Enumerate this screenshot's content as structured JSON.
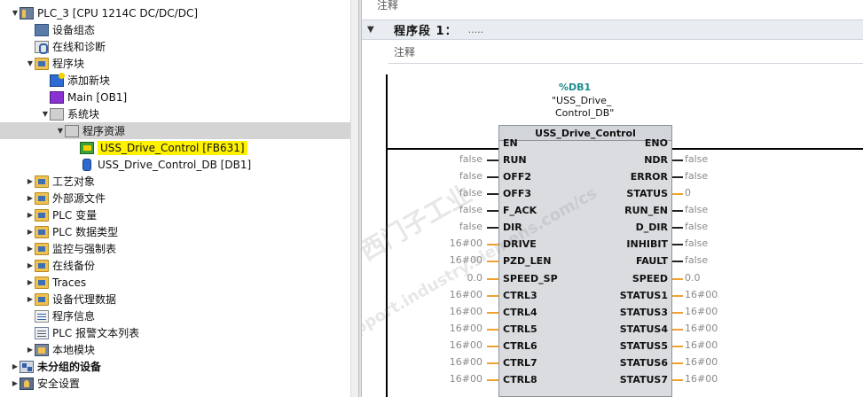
{
  "tree": {
    "items": [
      {
        "label": "PLC_3 [CPU 1214C DC/DC/DC]",
        "icon": "plc-icon",
        "arrow": "▼",
        "indent": 0,
        "bold": false
      },
      {
        "label": "设备组态",
        "icon": "device-config-icon",
        "arrow": "",
        "indent": 1
      },
      {
        "label": "在线和诊断",
        "icon": "online-diagnostics-icon",
        "arrow": "",
        "indent": 1
      },
      {
        "label": "程序块",
        "icon": "folder-icon",
        "arrow": "▼",
        "indent": 1
      },
      {
        "label": "添加新块",
        "icon": "add-block-icon",
        "arrow": "",
        "indent": 2
      },
      {
        "label": "Main [OB1]",
        "icon": "ob-icon",
        "arrow": "",
        "indent": 2
      },
      {
        "label": "系统块",
        "icon": "system-block-icon",
        "arrow": "▼",
        "indent": 2
      },
      {
        "label": "程序资源",
        "icon": "system-block-icon",
        "arrow": "▼",
        "indent": 3
      },
      {
        "label": "USS_Drive_Control [FB631]",
        "icon": "fb-icon",
        "arrow": "",
        "indent": 4
      },
      {
        "label": "USS_Drive_Control_DB [DB1]",
        "icon": "db-icon",
        "arrow": "",
        "indent": 4
      },
      {
        "label": "工艺对象",
        "icon": "folder-icon",
        "arrow": "▶",
        "indent": 1
      },
      {
        "label": "外部源文件",
        "icon": "folder-icon",
        "arrow": "▶",
        "indent": 1
      },
      {
        "label": "PLC 变量",
        "icon": "folder-icon",
        "arrow": "▶",
        "indent": 1
      },
      {
        "label": "PLC 数据类型",
        "icon": "folder-icon",
        "arrow": "▶",
        "indent": 1
      },
      {
        "label": "监控与强制表",
        "icon": "folder-icon",
        "arrow": "▶",
        "indent": 1
      },
      {
        "label": "在线备份",
        "icon": "folder-icon",
        "arrow": "▶",
        "indent": 1
      },
      {
        "label": "Traces",
        "icon": "folder-icon",
        "arrow": "▶",
        "indent": 1
      },
      {
        "label": "设备代理数据",
        "icon": "folder-icon",
        "arrow": "▶",
        "indent": 1
      },
      {
        "label": "程序信息",
        "icon": "program-info-icon",
        "arrow": "",
        "indent": 1
      },
      {
        "label": "PLC 报警文本列表",
        "icon": "list-icon",
        "arrow": "",
        "indent": 1
      },
      {
        "label": "本地模块",
        "icon": "local-module-icon",
        "arrow": "▶",
        "indent": 1
      },
      {
        "label": "未分组的设备",
        "icon": "ungrouped-devices-icon",
        "arrow": "▶",
        "indent": 0,
        "bold": true
      },
      {
        "label": "安全设置",
        "icon": "security-icon",
        "arrow": "▶",
        "indent": 0
      }
    ],
    "selected_index": 7,
    "highlight_index": 8
  },
  "editor": {
    "top_comment": "注释",
    "network_title": "程序段 1：",
    "network_dots": ".....",
    "network_comment": "注释",
    "db_ref": "%DB1",
    "db_name_line1": "\"USS_Drive_",
    "db_name_line2": "Control_DB\"",
    "block_title": "USS_Drive_Control",
    "inputs": [
      {
        "pin": "EN",
        "value": ""
      },
      {
        "pin": "RUN",
        "value": "false"
      },
      {
        "pin": "OFF2",
        "value": "false"
      },
      {
        "pin": "OFF3",
        "value": "false"
      },
      {
        "pin": "F_ACK",
        "value": "false"
      },
      {
        "pin": "DIR",
        "value": "false"
      },
      {
        "pin": "DRIVE",
        "value": "16#00"
      },
      {
        "pin": "PZD_LEN",
        "value": "16#00"
      },
      {
        "pin": "SPEED_SP",
        "value": "0.0"
      },
      {
        "pin": "CTRL3",
        "value": "16#00"
      },
      {
        "pin": "CTRL4",
        "value": "16#00"
      },
      {
        "pin": "CTRL5",
        "value": "16#00"
      },
      {
        "pin": "CTRL6",
        "value": "16#00"
      },
      {
        "pin": "CTRL7",
        "value": "16#00"
      },
      {
        "pin": "CTRL8",
        "value": "16#00"
      }
    ],
    "outputs": [
      {
        "pin": "ENO",
        "value": ""
      },
      {
        "pin": "NDR",
        "value": "false"
      },
      {
        "pin": "ERROR",
        "value": "false"
      },
      {
        "pin": "STATUS",
        "value": "0"
      },
      {
        "pin": "RUN_EN",
        "value": "false"
      },
      {
        "pin": "D_DIR",
        "value": "false"
      },
      {
        "pin": "INHIBIT",
        "value": "false"
      },
      {
        "pin": "FAULT",
        "value": "false"
      },
      {
        "pin": "SPEED",
        "value": "0.0"
      },
      {
        "pin": "STATUS1",
        "value": "16#00"
      },
      {
        "pin": "STATUS3",
        "value": "16#00"
      },
      {
        "pin": "STATUS4",
        "value": "16#00"
      },
      {
        "pin": "STATUS5",
        "value": "16#00"
      },
      {
        "pin": "STATUS6",
        "value": "16#00"
      },
      {
        "pin": "STATUS7",
        "value": "16#00"
      }
    ],
    "watermark_lines": [
      "西门子工业",
      "support.industry.siemens.com/cs"
    ]
  },
  "colors": {
    "highlight": "#fff200",
    "selected_row": "#d4d4d4",
    "db_ref": "#1d8c8c",
    "bool_wire": "#222222",
    "value_wire": "#f0a030"
  }
}
